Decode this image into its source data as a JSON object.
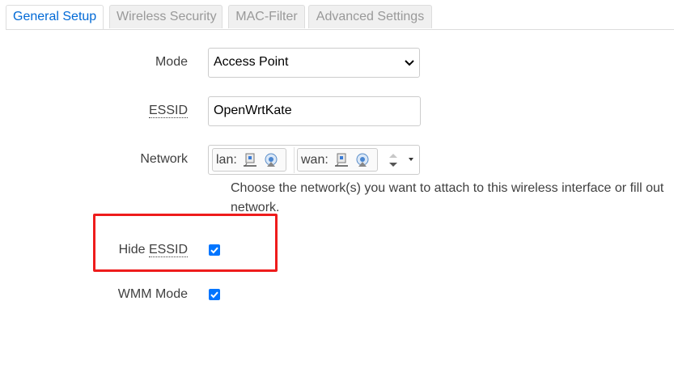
{
  "tabs": [
    {
      "label": "General Setup",
      "active": true
    },
    {
      "label": "Wireless Security",
      "active": false
    },
    {
      "label": "MAC-Filter",
      "active": false
    },
    {
      "label": "Advanced Settings",
      "active": false
    }
  ],
  "form": {
    "mode": {
      "label": "Mode",
      "value": "Access Point"
    },
    "essid": {
      "label": "ESSID",
      "value": "OpenWrtKate"
    },
    "network": {
      "label": "Network",
      "chips": [
        {
          "label": "lan:",
          "icons": [
            "ethernet-port-icon",
            "wireless-network-icon"
          ]
        },
        {
          "label": "wan:",
          "icons": [
            "ethernet-port-icon",
            "wireless-network-icon"
          ]
        }
      ],
      "help": "Choose the network(s) you want to attach to this wireless interface or fill out network."
    },
    "hide_essid": {
      "label_prefix": "Hide ",
      "label_abbr": "ESSID",
      "checked": true
    },
    "wmm_mode": {
      "label": "WMM Mode",
      "checked": true
    }
  },
  "colors": {
    "accent": "#0069d6",
    "checkbox": "#0075ff",
    "highlight_box": "#ee1c1c",
    "inactive_tab_text": "#999999"
  }
}
